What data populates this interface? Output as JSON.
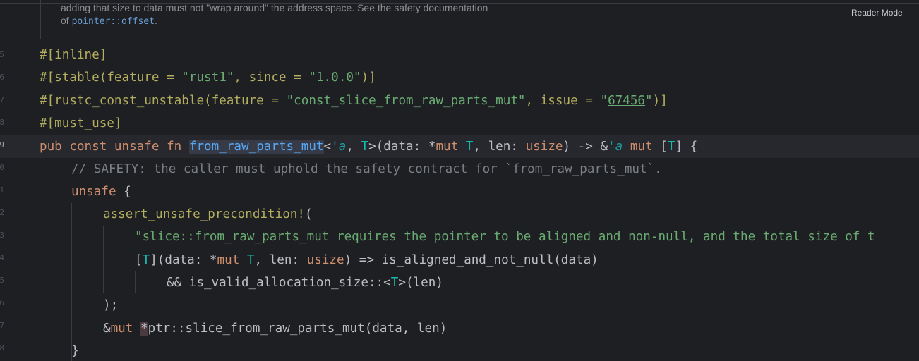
{
  "editor": {
    "reader_mode_label": "Reader Mode",
    "gutter_numbers": [
      "5",
      "6",
      "7",
      "8",
      "9",
      "0",
      "1",
      "2",
      "3",
      "4",
      "5",
      "6",
      "7",
      "8"
    ],
    "doc": {
      "line1": "adding that size to data must not \"wrap around\" the address space. See the safety documentation",
      "line2_prefix": "of ",
      "line2_link": "pointer::offset",
      "line2_suffix": "."
    },
    "code": {
      "attr_inline": "#[inline]",
      "stable_open": "#[stable(feature = ",
      "stable_feature": "\"rust1\"",
      "stable_mid": ", since = ",
      "stable_since": "\"1.0.0\"",
      "stable_close": ")]",
      "rcu_open": "#[rustc_const_unstable(feature = ",
      "rcu_feature": "\"const_slice_from_raw_parts_mut\"",
      "rcu_mid": ", issue = ",
      "rcu_issue_q1": "\"",
      "rcu_issue_num": "67456",
      "rcu_issue_q2": "\"",
      "rcu_close": ")]",
      "attr_must_use": "#[must_use]",
      "sig_kw": "pub const unsafe fn ",
      "sig_name": "from_raw_parts_mut",
      "sig_lt_open": "<",
      "sig_lifetime1": "'a",
      "sig_gen_sep": ", ",
      "sig_T1": "T",
      "sig_gen_close": ">(",
      "sig_data": "data",
      "sig_colon1": ": *",
      "sig_mut1": "mut",
      "sig_sp1": " ",
      "sig_T2": "T",
      "sig_comma": ", ",
      "sig_len": "len",
      "sig_colon2": ": ",
      "sig_usize": "usize",
      "sig_arrow": ") -> &",
      "sig_lifetime2": "'a",
      "sig_sp2": " ",
      "sig_mut2": "mut",
      "sig_br_open": " [",
      "sig_T3": "T",
      "sig_br_close": "] {",
      "comment": "// SAFETY: the caller must uphold the safety contract for `from_raw_parts_mut`.",
      "unsafe_kw": "unsafe",
      "unsafe_brace": " {",
      "macro_name": "assert_unsafe_precondition!",
      "macro_paren": "(",
      "macro_msg": "\"slice::from_raw_parts_mut requires the pointer to be aligned and non-null, and the total size of t",
      "arm_open": "[",
      "arm_T1": "T",
      "arm_p1": "](",
      "arm_data": "data",
      "arm_colon": ": *",
      "arm_mut": "mut",
      "arm_sp": " ",
      "arm_T2": "T",
      "arm_comma": ", ",
      "arm_len": "len",
      "arm_colon2": ": ",
      "arm_usize": "usize",
      "arm_rest": ") => is_aligned_and_not_null(data)",
      "and_prefix": "&& is_valid_allocation_size::<",
      "and_T": "T",
      "and_suffix": ">(len)",
      "close_paren": ");",
      "ret_amp": "&",
      "ret_mut": "mut",
      "ret_sp": " ",
      "ret_star": "*",
      "ret_rest": "ptr::slice_from_raw_parts_mut(data, len)",
      "close_brace": "}"
    }
  }
}
